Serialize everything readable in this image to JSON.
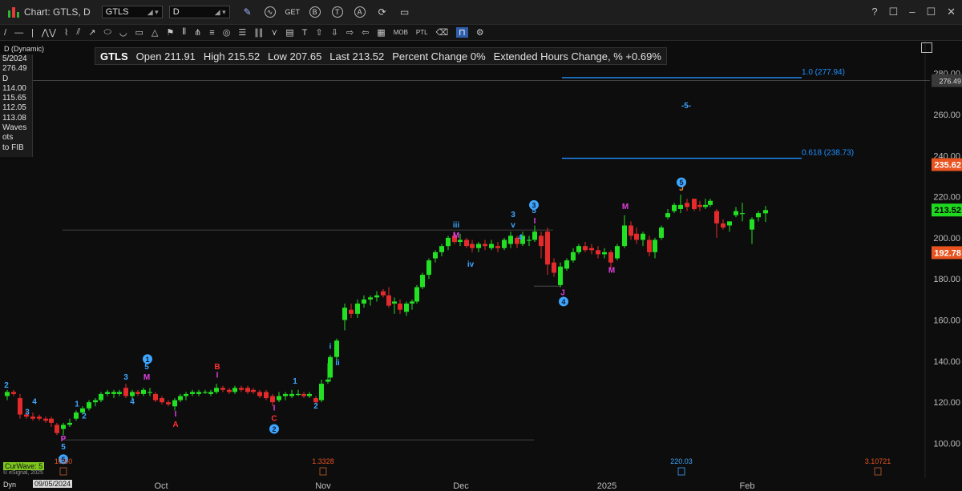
{
  "window": {
    "title": "Chart: GTLS, D",
    "symbol_value": "GTLS",
    "interval_value": "D",
    "controls": [
      "?",
      "☐",
      "–",
      "☐",
      "✕"
    ]
  },
  "toolbar": {
    "icons": [
      "pencil-icon",
      "wave-icon",
      "get-icon",
      "b-circle-icon",
      "t-circle-icon",
      "a-circle-icon",
      "refresh-icon",
      "note-icon"
    ],
    "get_label": "GET",
    "b_label": "B",
    "t_label": "T",
    "a_label": "A"
  },
  "drawing_toolbar": {
    "labels": [
      "MOB",
      "PTL"
    ]
  },
  "info": {
    "symbol": "GTLS",
    "open_label": "Open",
    "open": "211.91",
    "high_label": "High",
    "high": "215.52",
    "low_label": "Low",
    "low": "207.65",
    "last_label": "Last",
    "last": "213.52",
    "pct_label": "Percent Change",
    "pct": "0%",
    "ext_label": "Extended Hours Change, %",
    "ext": "+0.69%"
  },
  "dynamic_label": "D (Dynamic)",
  "side_panel": [
    "5/2024",
    "276.49",
    "D",
    "114.00",
    "115.65",
    "112.05",
    "113.08",
    "Waves",
    "ots",
    "to FIB"
  ],
  "footer": {
    "curwave": "CurWave: 5",
    "esignal": "© eSignal, 2025",
    "dyn": "Dyn",
    "date_box": "09/05/2024",
    "bottom_values": [
      {
        "text": "10.60",
        "x": 79
      },
      {
        "text": "1.3328",
        "x": 403
      },
      {
        "text": "220.03",
        "x": 850
      },
      {
        "text": "3.10721",
        "x": 1095
      }
    ]
  },
  "colors": {
    "up": "#22e022",
    "down": "#e42a2a",
    "fib": "#1e90ff",
    "wave_blue": "#3ea6ff",
    "wave_magenta": "#e040e0",
    "wave_red": "#ff3030",
    "price_red": "#e8531f",
    "price_green": "#1fd81f"
  },
  "chart_data": {
    "type": "candlestick",
    "symbol": "GTLS",
    "interval": "D",
    "x_labels": [
      "Oct",
      "Nov",
      "Dec",
      "2025",
      "Feb"
    ],
    "y_ticks": [
      100,
      120,
      140,
      160,
      180,
      200,
      220,
      240,
      260,
      280
    ],
    "ylim": [
      92,
      292
    ],
    "candles": [
      {
        "x": 9,
        "o": 123,
        "h": 126,
        "l": 121,
        "c": 125
      },
      {
        "x": 17,
        "o": 125,
        "h": 126,
        "l": 123,
        "c": 124
      },
      {
        "x": 25,
        "o": 122,
        "h": 124,
        "l": 112,
        "c": 114
      },
      {
        "x": 33,
        "o": 114,
        "h": 116,
        "l": 112,
        "c": 113
      },
      {
        "x": 41,
        "o": 113,
        "h": 115,
        "l": 111,
        "c": 112
      },
      {
        "x": 49,
        "o": 113,
        "h": 114,
        "l": 111,
        "c": 112
      },
      {
        "x": 57,
        "o": 112,
        "h": 113,
        "l": 110,
        "c": 111
      },
      {
        "x": 64,
        "o": 112,
        "h": 113,
        "l": 108,
        "c": 110
      },
      {
        "x": 71,
        "o": 109,
        "h": 110,
        "l": 104,
        "c": 105
      },
      {
        "x": 79,
        "o": 107,
        "h": 110,
        "l": 104,
        "c": 109
      },
      {
        "x": 87,
        "o": 109,
        "h": 112,
        "l": 108,
        "c": 110
      },
      {
        "x": 95,
        "o": 112,
        "h": 116,
        "l": 111,
        "c": 115
      },
      {
        "x": 103,
        "o": 115,
        "h": 118,
        "l": 114,
        "c": 117
      },
      {
        "x": 111,
        "o": 117,
        "h": 121,
        "l": 116,
        "c": 120
      },
      {
        "x": 119,
        "o": 120,
        "h": 122,
        "l": 118,
        "c": 121
      },
      {
        "x": 126,
        "o": 121,
        "h": 125,
        "l": 120,
        "c": 124
      },
      {
        "x": 134,
        "o": 124,
        "h": 126,
        "l": 123,
        "c": 125
      },
      {
        "x": 142,
        "o": 124,
        "h": 126,
        "l": 122,
        "c": 125
      },
      {
        "x": 149,
        "o": 124,
        "h": 126,
        "l": 123,
        "c": 125
      },
      {
        "x": 157,
        "o": 127,
        "h": 129,
        "l": 122,
        "c": 123
      },
      {
        "x": 165,
        "o": 123,
        "h": 126,
        "l": 121,
        "c": 125
      },
      {
        "x": 172,
        "o": 125,
        "h": 126,
        "l": 123,
        "c": 124
      },
      {
        "x": 179,
        "o": 124,
        "h": 127,
        "l": 123,
        "c": 126
      },
      {
        "x": 187,
        "o": 125,
        "h": 127,
        "l": 123,
        "c": 125
      },
      {
        "x": 194,
        "o": 124,
        "h": 125,
        "l": 120,
        "c": 121
      },
      {
        "x": 202,
        "o": 122,
        "h": 123,
        "l": 119,
        "c": 120
      },
      {
        "x": 210,
        "o": 120,
        "h": 121,
        "l": 118,
        "c": 119
      },
      {
        "x": 218,
        "o": 118,
        "h": 122,
        "l": 116,
        "c": 121
      },
      {
        "x": 225,
        "o": 121,
        "h": 124,
        "l": 120,
        "c": 123
      },
      {
        "x": 232,
        "o": 123,
        "h": 125,
        "l": 121,
        "c": 124
      },
      {
        "x": 240,
        "o": 124,
        "h": 126,
        "l": 123,
        "c": 125
      },
      {
        "x": 248,
        "o": 124,
        "h": 126,
        "l": 123,
        "c": 125
      },
      {
        "x": 256,
        "o": 125,
        "h": 126,
        "l": 124,
        "c": 125
      },
      {
        "x": 263,
        "o": 124,
        "h": 126,
        "l": 123,
        "c": 125
      },
      {
        "x": 270,
        "o": 125,
        "h": 129,
        "l": 124,
        "c": 127
      },
      {
        "x": 278,
        "o": 127,
        "h": 128,
        "l": 125,
        "c": 126
      },
      {
        "x": 286,
        "o": 126,
        "h": 127,
        "l": 124,
        "c": 125
      },
      {
        "x": 293,
        "o": 125,
        "h": 128,
        "l": 124,
        "c": 127
      },
      {
        "x": 301,
        "o": 127,
        "h": 128,
        "l": 125,
        "c": 126
      },
      {
        "x": 309,
        "o": 127,
        "h": 128,
        "l": 124,
        "c": 125
      },
      {
        "x": 316,
        "o": 126,
        "h": 127,
        "l": 124,
        "c": 125
      },
      {
        "x": 324,
        "o": 125,
        "h": 126,
        "l": 122,
        "c": 123
      },
      {
        "x": 332,
        "o": 125,
        "h": 126,
        "l": 121,
        "c": 122
      },
      {
        "x": 340,
        "o": 123,
        "h": 124,
        "l": 118,
        "c": 120
      },
      {
        "x": 348,
        "o": 121,
        "h": 125,
        "l": 120,
        "c": 123
      },
      {
        "x": 356,
        "o": 123,
        "h": 125,
        "l": 121,
        "c": 124
      },
      {
        "x": 364,
        "o": 123,
        "h": 126,
        "l": 122,
        "c": 124
      },
      {
        "x": 372,
        "o": 124,
        "h": 126,
        "l": 123,
        "c": 124
      },
      {
        "x": 379,
        "o": 124,
        "h": 125,
        "l": 122,
        "c": 123
      },
      {
        "x": 386,
        "o": 123,
        "h": 125,
        "l": 122,
        "c": 124
      },
      {
        "x": 394,
        "o": 122,
        "h": 123,
        "l": 119,
        "c": 120
      },
      {
        "x": 401,
        "o": 121,
        "h": 131,
        "l": 120,
        "c": 129
      },
      {
        "x": 409,
        "o": 130,
        "h": 139,
        "l": 129,
        "c": 131
      },
      {
        "x": 412,
        "o": 132,
        "h": 143,
        "l": 130,
        "c": 142
      },
      {
        "x": 420,
        "o": 142,
        "h": 151,
        "l": 140,
        "c": 150
      },
      {
        "x": 430,
        "o": 160,
        "h": 168,
        "l": 155,
        "c": 166
      },
      {
        "x": 438,
        "o": 165,
        "h": 168,
        "l": 161,
        "c": 163
      },
      {
        "x": 446,
        "o": 163,
        "h": 170,
        "l": 161,
        "c": 168
      },
      {
        "x": 454,
        "o": 168,
        "h": 172,
        "l": 166,
        "c": 170
      },
      {
        "x": 462,
        "o": 170,
        "h": 172,
        "l": 167,
        "c": 171
      },
      {
        "x": 470,
        "o": 171,
        "h": 174,
        "l": 169,
        "c": 172
      },
      {
        "x": 478,
        "o": 174,
        "h": 175,
        "l": 171,
        "c": 172
      },
      {
        "x": 485,
        "o": 172,
        "h": 176,
        "l": 166,
        "c": 167
      },
      {
        "x": 492,
        "o": 168,
        "h": 171,
        "l": 163,
        "c": 169
      },
      {
        "x": 499,
        "o": 168,
        "h": 170,
        "l": 163,
        "c": 165
      },
      {
        "x": 507,
        "o": 164,
        "h": 169,
        "l": 162,
        "c": 168
      },
      {
        "x": 514,
        "o": 168,
        "h": 170,
        "l": 165,
        "c": 169
      },
      {
        "x": 520,
        "o": 169,
        "h": 177,
        "l": 168,
        "c": 176
      },
      {
        "x": 527,
        "o": 176,
        "h": 183,
        "l": 175,
        "c": 182
      },
      {
        "x": 535,
        "o": 182,
        "h": 190,
        "l": 180,
        "c": 189
      },
      {
        "x": 543,
        "o": 190,
        "h": 194,
        "l": 188,
        "c": 193
      },
      {
        "x": 551,
        "o": 193,
        "h": 197,
        "l": 191,
        "c": 196
      },
      {
        "x": 559,
        "o": 196,
        "h": 201,
        "l": 194,
        "c": 200
      },
      {
        "x": 567,
        "o": 201,
        "h": 203,
        "l": 197,
        "c": 198
      },
      {
        "x": 574,
        "o": 198,
        "h": 202,
        "l": 196,
        "c": 199
      },
      {
        "x": 582,
        "o": 199,
        "h": 200,
        "l": 195,
        "c": 196
      },
      {
        "x": 589,
        "o": 197,
        "h": 199,
        "l": 193,
        "c": 195
      },
      {
        "x": 597,
        "o": 195,
        "h": 198,
        "l": 193,
        "c": 197
      },
      {
        "x": 605,
        "o": 197,
        "h": 199,
        "l": 194,
        "c": 196
      },
      {
        "x": 613,
        "o": 195,
        "h": 199,
        "l": 194,
        "c": 197
      },
      {
        "x": 621,
        "o": 196,
        "h": 198,
        "l": 193,
        "c": 195
      },
      {
        "x": 629,
        "o": 195,
        "h": 200,
        "l": 194,
        "c": 199
      },
      {
        "x": 637,
        "o": 197,
        "h": 203,
        "l": 195,
        "c": 201
      },
      {
        "x": 645,
        "o": 200,
        "h": 201,
        "l": 195,
        "c": 197
      },
      {
        "x": 652,
        "o": 197,
        "h": 203,
        "l": 196,
        "c": 201
      },
      {
        "x": 660,
        "o": 199,
        "h": 201,
        "l": 196,
        "c": 199
      },
      {
        "x": 667,
        "o": 199,
        "h": 206,
        "l": 198,
        "c": 203
      },
      {
        "x": 675,
        "o": 201,
        "h": 203,
        "l": 190,
        "c": 196
      },
      {
        "x": 683,
        "o": 203,
        "h": 205,
        "l": 182,
        "c": 187
      },
      {
        "x": 691,
        "o": 188,
        "h": 190,
        "l": 181,
        "c": 183
      },
      {
        "x": 699,
        "o": 177,
        "h": 188,
        "l": 176,
        "c": 186
      },
      {
        "x": 707,
        "o": 185,
        "h": 190,
        "l": 184,
        "c": 189
      },
      {
        "x": 715,
        "o": 189,
        "h": 195,
        "l": 188,
        "c": 193
      },
      {
        "x": 722,
        "o": 193,
        "h": 197,
        "l": 192,
        "c": 196
      },
      {
        "x": 730,
        "o": 196,
        "h": 198,
        "l": 193,
        "c": 194
      },
      {
        "x": 738,
        "o": 195,
        "h": 197,
        "l": 192,
        "c": 194
      },
      {
        "x": 746,
        "o": 194,
        "h": 196,
        "l": 190,
        "c": 192
      },
      {
        "x": 754,
        "o": 192,
        "h": 195,
        "l": 190,
        "c": 193
      },
      {
        "x": 762,
        "o": 193,
        "h": 194,
        "l": 185,
        "c": 188
      },
      {
        "x": 770,
        "o": 190,
        "h": 197,
        "l": 189,
        "c": 196
      },
      {
        "x": 779,
        "o": 196,
        "h": 211,
        "l": 195,
        "c": 206
      },
      {
        "x": 787,
        "o": 206,
        "h": 208,
        "l": 199,
        "c": 201
      },
      {
        "x": 794,
        "o": 202,
        "h": 205,
        "l": 197,
        "c": 199
      },
      {
        "x": 802,
        "o": 199,
        "h": 203,
        "l": 196,
        "c": 202
      },
      {
        "x": 810,
        "o": 199,
        "h": 201,
        "l": 191,
        "c": 193
      },
      {
        "x": 817,
        "o": 193,
        "h": 200,
        "l": 190,
        "c": 199
      },
      {
        "x": 825,
        "o": 200,
        "h": 206,
        "l": 199,
        "c": 205
      },
      {
        "x": 833,
        "o": 210,
        "h": 214,
        "l": 209,
        "c": 212
      },
      {
        "x": 841,
        "o": 213,
        "h": 217,
        "l": 212,
        "c": 216
      },
      {
        "x": 849,
        "o": 214,
        "h": 221,
        "l": 212,
        "c": 216
      },
      {
        "x": 857,
        "o": 217,
        "h": 219,
        "l": 213,
        "c": 215
      },
      {
        "x": 866,
        "o": 219,
        "h": 219,
        "l": 213,
        "c": 214
      },
      {
        "x": 873,
        "o": 216,
        "h": 218,
        "l": 213,
        "c": 215
      },
      {
        "x": 880,
        "o": 215,
        "h": 219,
        "l": 214,
        "c": 216
      },
      {
        "x": 886,
        "o": 216,
        "h": 219,
        "l": 215,
        "c": 218
      },
      {
        "x": 894,
        "o": 213,
        "h": 214,
        "l": 200,
        "c": 207
      },
      {
        "x": 902,
        "o": 207,
        "h": 209,
        "l": 204,
        "c": 205
      },
      {
        "x": 910,
        "o": 206,
        "h": 208,
        "l": 203,
        "c": 208
      },
      {
        "x": 918,
        "o": 211,
        "h": 215,
        "l": 210,
        "c": 213
      },
      {
        "x": 926,
        "o": 212,
        "h": 217,
        "l": 208,
        "c": 212
      },
      {
        "x": 938,
        "o": 204,
        "h": 210,
        "l": 197,
        "c": 209
      },
      {
        "x": 946,
        "o": 210,
        "h": 213,
        "l": 208,
        "c": 212
      },
      {
        "x": 955,
        "o": 211.91,
        "h": 215.52,
        "l": 207.65,
        "c": 213.52
      }
    ],
    "fib_levels": [
      {
        "label": "1.0  (277.94)",
        "value": 277.94
      },
      {
        "label": "0.618  (238.73)",
        "value": 238.73
      }
    ],
    "reference_lines": [
      {
        "value": 276.49,
        "style": "gray"
      },
      {
        "value": 203.8,
        "style": "gray"
      },
      {
        "value": 101.7,
        "style": "gray"
      },
      {
        "value": 176.5,
        "style": "gray"
      }
    ],
    "wave_labels": [
      {
        "t": "2",
        "x": 8,
        "p": 127,
        "c": "blue"
      },
      {
        "t": "3",
        "x": 34,
        "p": 114,
        "c": "blue"
      },
      {
        "t": "4",
        "x": 43,
        "p": 119,
        "c": "blue"
      },
      {
        "t": "P",
        "x": 79,
        "p": 101,
        "c": "magenta"
      },
      {
        "t": "5",
        "x": 79,
        "p": 97,
        "c": "blue"
      },
      {
        "t": "1",
        "x": 96,
        "p": 118,
        "c": "blue"
      },
      {
        "t": "2",
        "x": 105,
        "p": 112,
        "c": "blue"
      },
      {
        "t": "3",
        "x": 157,
        "p": 131,
        "c": "blue"
      },
      {
        "t": "4",
        "x": 165,
        "p": 119,
        "c": "blue"
      },
      {
        "t": "5",
        "x": 183,
        "p": 136,
        "c": "blue"
      },
      {
        "t": "M",
        "x": 183,
        "p": 131,
        "c": "magenta"
      },
      {
        "t": "I",
        "x": 219,
        "p": 113,
        "c": "magenta"
      },
      {
        "t": "A",
        "x": 219,
        "p": 108,
        "c": "red"
      },
      {
        "t": "B",
        "x": 271,
        "p": 136,
        "c": "red"
      },
      {
        "t": "I",
        "x": 271,
        "p": 132,
        "c": "magenta"
      },
      {
        "t": "I",
        "x": 342,
        "p": 116,
        "c": "magenta"
      },
      {
        "t": "C",
        "x": 342,
        "p": 111,
        "c": "red"
      },
      {
        "t": "1",
        "x": 368,
        "p": 129,
        "c": "blue"
      },
      {
        "t": "2",
        "x": 394,
        "p": 117,
        "c": "blue"
      },
      {
        "t": "i",
        "x": 412,
        "p": 146,
        "c": "blue"
      },
      {
        "t": "ii",
        "x": 421,
        "p": 138,
        "c": "blue"
      },
      {
        "t": "iii",
        "x": 569,
        "p": 205,
        "c": "blue"
      },
      {
        "t": "M",
        "x": 569,
        "p": 200,
        "c": "magenta"
      },
      {
        "t": "iv",
        "x": 587,
        "p": 186,
        "c": "blue"
      },
      {
        "t": "3",
        "x": 640,
        "p": 210,
        "c": "blue"
      },
      {
        "t": "v",
        "x": 640,
        "p": 205,
        "c": "blue"
      },
      {
        "t": "4",
        "x": 649,
        "p": 199,
        "c": "blue"
      },
      {
        "t": "5",
        "x": 666,
        "p": 212,
        "c": "blue"
      },
      {
        "t": "I",
        "x": 667,
        "p": 207,
        "c": "magenta"
      },
      {
        "t": "J",
        "x": 702,
        "p": 172,
        "c": "magenta"
      },
      {
        "t": "M",
        "x": 780,
        "p": 214,
        "c": "magenta"
      },
      {
        "t": "M",
        "x": 763,
        "p": 183,
        "c": "magenta"
      },
      {
        "t": "J",
        "x": 850,
        "p": 223,
        "c": "orange"
      },
      {
        "t": "-5-",
        "x": 856,
        "p": 263,
        "c": "blue"
      }
    ],
    "circled_labels": [
      {
        "t": "5",
        "x": 79,
        "p": 92.3
      },
      {
        "t": "1",
        "x": 184,
        "p": 141
      },
      {
        "t": "2",
        "x": 342,
        "p": 107
      },
      {
        "t": "3",
        "x": 666,
        "p": 216
      },
      {
        "t": "4",
        "x": 703,
        "p": 169
      },
      {
        "t": "5",
        "x": 850,
        "p": 227
      }
    ],
    "price_markers": [
      {
        "text": "276.49",
        "value": 276.49,
        "bg": "#3a3a3a",
        "fg": "#ddd"
      },
      {
        "text": "235.62",
        "value": 235.62,
        "bg": "#e8531f",
        "fg": "#fff"
      },
      {
        "text": "213.52",
        "value": 213.52,
        "bg": "#1fd81f",
        "fg": "#000"
      },
      {
        "text": "192.78",
        "value": 192.78,
        "bg": "#e8531f",
        "fg": "#fff"
      }
    ]
  }
}
